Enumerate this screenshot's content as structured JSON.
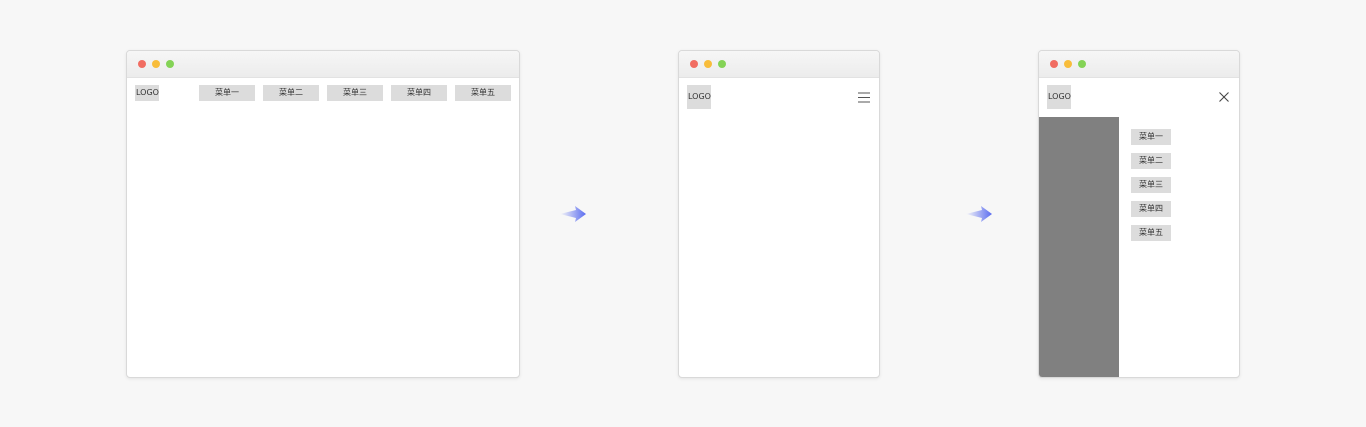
{
  "desktop": {
    "logo": "LOGO",
    "menu": [
      "菜单一",
      "菜单二",
      "菜单三",
      "菜单四",
      "菜单五"
    ]
  },
  "mobile": {
    "logo": "LOGO",
    "menu_icon": "hamburger-icon"
  },
  "mobile_open": {
    "logo": "LOGO",
    "close_icon": "close-icon",
    "menu": [
      "菜单一",
      "菜单二",
      "菜单三",
      "菜单四",
      "菜单五"
    ]
  },
  "colors": {
    "page_bg": "#f7f7f7",
    "menu_bg": "#dcdcdc",
    "overlay": "#808080",
    "arrow": "#5a6cf0",
    "dot_red": "#f16d62",
    "dot_yellow": "#f8bd3b",
    "dot_green": "#84d356"
  }
}
